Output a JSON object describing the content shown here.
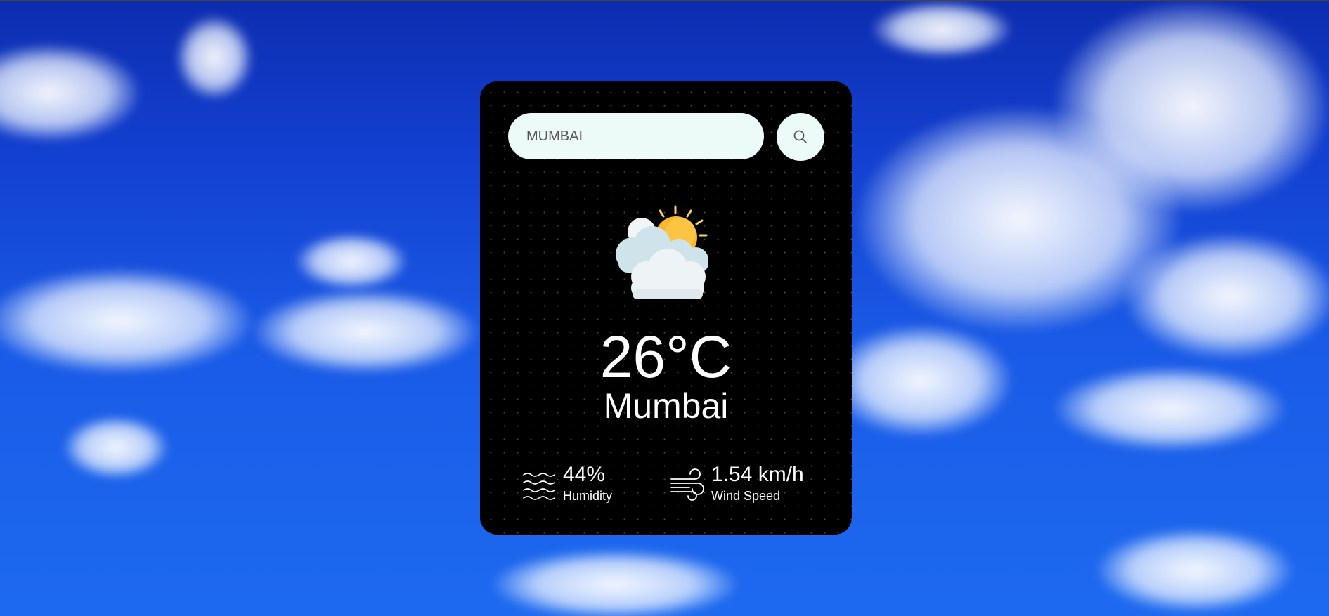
{
  "search": {
    "value": "MUMBAI"
  },
  "weather": {
    "icon": "partly-cloudy-icon",
    "temperature": "26°C",
    "city": "Mumbai"
  },
  "details": {
    "humidity": {
      "value": "44%",
      "label": "Humidity",
      "icon": "humidity-waves-icon"
    },
    "wind": {
      "value": "1.54 km/h",
      "label": "Wind Speed",
      "icon": "wind-icon"
    }
  },
  "colors": {
    "card_background": "#000000",
    "input_background": "#ecfbf7",
    "text": "#ffffff",
    "sky": "#1a5ae6"
  }
}
